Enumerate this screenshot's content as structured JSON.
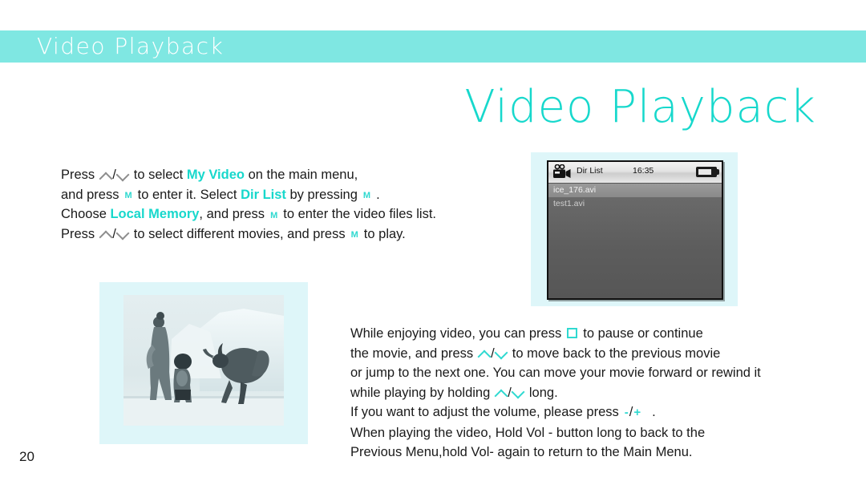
{
  "header": {
    "band_label": "Video Playback",
    "band_color": "#7FE7E2"
  },
  "page_title": "Video Playback",
  "accent_color": "#17D8CC",
  "instructions_top": {
    "line1": {
      "a": "Press",
      "key1": "chevron-up",
      "slash": "/",
      "key2": "chevron-down",
      "b": "to select",
      "kw": "My Video",
      "c": "on the main menu,"
    },
    "line2": {
      "a": "and press",
      "key1": "M",
      "b": "to enter it. Select",
      "kw": "Dir List",
      "c": "by pressing",
      "key2": "M",
      "d": "."
    },
    "line3": {
      "a": "Choose",
      "kw": "Local Memory",
      "b": ", and press",
      "key1": "M",
      "c": "to enter the video files list."
    },
    "line4": {
      "a": "Press",
      "key1": "chevron-up",
      "slash": "/",
      "key2": "chevron-down",
      "b": "to select different movies, and press",
      "key3": "M",
      "c": "to play."
    }
  },
  "instructions_bottom": {
    "line1": {
      "a": "While enjoying video, you can press",
      "key1": "square",
      "b": "to pause or continue"
    },
    "line2": {
      "a": "the movie, and press",
      "key1": "chevron-up",
      "slash": "/",
      "key2": "chevron-down",
      "b": "to move back to the previous movie"
    },
    "line3": "or jump to the next one. You can move your movie forward or rewind it",
    "line4": {
      "a": "while playing by holding",
      "key1": "chevron-up",
      "slash": "/",
      "key2": "chevron-down",
      "b": "long."
    },
    "line5": {
      "a": "If you want to adjust the volume, please press",
      "minus": "-",
      "slash": "/",
      "plus": "+",
      "b": "."
    },
    "line6": "When playing the video, Hold Vol - button long to back to the",
    "line7": "Previous Menu,hold Vol- again to return to the Main Menu."
  },
  "device": {
    "status_title": "Dir List",
    "status_time": "16:35",
    "icons": {
      "camera": "video-camera-icon",
      "battery": "battery-icon"
    },
    "files": [
      {
        "name": "ice_176.avi",
        "selected": true
      },
      {
        "name": "test1.avi",
        "selected": false
      }
    ]
  },
  "movie_still": {
    "caption": "ice-age-movie-still"
  },
  "page_number": "20"
}
